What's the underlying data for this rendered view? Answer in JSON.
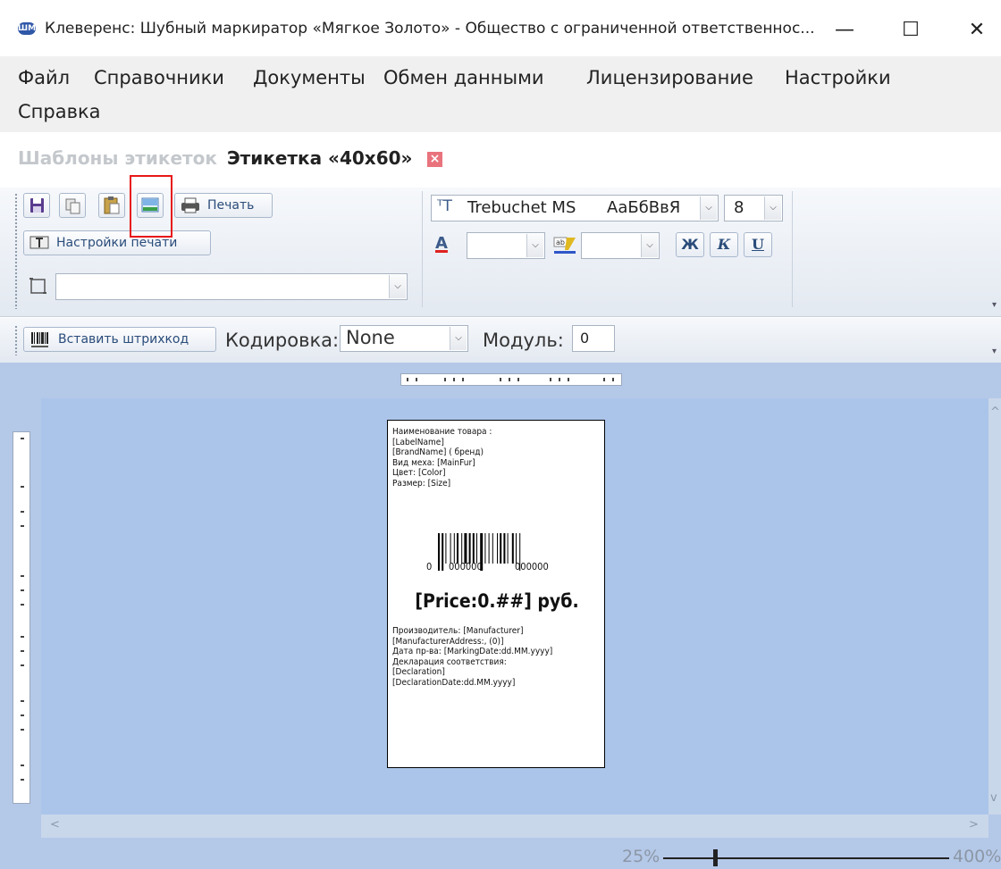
{
  "window": {
    "app_icon": "ШМ",
    "title": "Клеверенс: Шубный маркиратор «Мягкое Золото» - Общество с ограниченной ответственнос...",
    "minimize": "—",
    "maximize": "☐",
    "close": "✕"
  },
  "menu": {
    "file": "Файл",
    "references": "Справочники",
    "documents": "Документы",
    "exchange": "Обмен данными",
    "licensing": "Лицензирование",
    "settings": "Настройки",
    "help": "Справка"
  },
  "breadcrumb": {
    "parent": "Шаблоны этикеток",
    "current": "Этикетка «40x60»",
    "close_glyph": "×"
  },
  "ribbon": {
    "print_label": "Печать",
    "print_settings_label": "Настройки печати",
    "font_name": "Trebuchet MS",
    "font_preview": "АаБбВвЯ",
    "font_size": "8",
    "bold": "Ж",
    "italic": "К",
    "underline": "U",
    "font_color_glyph": "A",
    "object_combo_value": ""
  },
  "barcode_bar": {
    "insert_barcode_label": "Вставить штрихкод",
    "encoding_label": "Кодировка:",
    "encoding_value": "None",
    "module_label": "Модуль:",
    "module_value": "0"
  },
  "label_template": {
    "lines_top": [
      "Наименование товара :",
      "[LabelName]",
      "[BrandName] ( бренд)",
      "Вид меха:  [MainFur]",
      "Цвет:  [Color]",
      "Размер:  [Size]"
    ],
    "barcode_digits_left": "0",
    "barcode_digits_mid": "000000",
    "barcode_digits_right": "000000",
    "price": "[Price:0.##]  руб.",
    "lines_bottom": [
      "Производитель:  [Manufacturer]",
      "[ManufacturerAddress:, (0)]",
      "Дата пр-ва:  [MarkingDate:dd.MM.yyyy]",
      "Декларация соответствия:",
      "[Declaration]",
      "[DeclarationDate:dd.MM.yyyy]"
    ]
  },
  "zoom": {
    "min_label": "25%",
    "max_label": "400%",
    "level_fraction": 0.18
  },
  "icons": {
    "save": "floppy-icon",
    "copy": "copy-icon",
    "paste": "paste-icon",
    "insert_image": "image-icon",
    "print": "printer-icon",
    "print_settings": "print-settings-icon",
    "barcode": "barcode-icon",
    "object": "object-frame-icon"
  },
  "colors": {
    "highlight": "#e81818",
    "canvas": "#b4c8e8",
    "close_badge": "#e9737d"
  }
}
